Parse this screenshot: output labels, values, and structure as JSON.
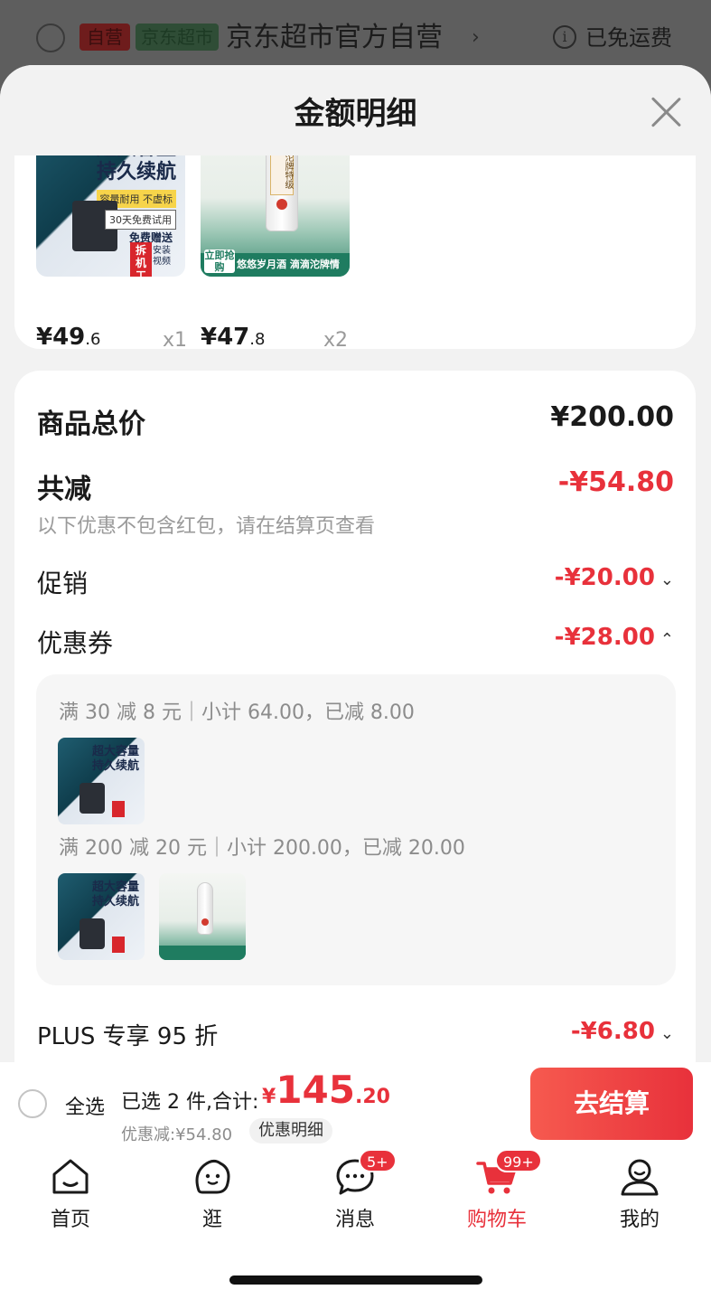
{
  "background_header": {
    "tag_self_run": "自营",
    "tag_supermarket": "京东超市",
    "store_name": "京东超市官方自营",
    "arrow": "›",
    "info_icon_glyph": "i",
    "shipping": "已免运费"
  },
  "sheet": {
    "title": "金额明细",
    "goods": [
      {
        "image_text": [
          "超大容量",
          "持久续航"
        ],
        "badge": "容量耐用 不虚标",
        "trial": "30天免费试用",
        "gift": "免费赠送",
        "red_tag": "拆机工具",
        "video": "安装视频",
        "price_int": "¥49",
        "price_dec": ".6",
        "qty": "x1"
      },
      {
        "image_text": [
          "沱牌特级"
        ],
        "band_text": "悠悠岁月酒 滴滴沱牌情",
        "grab_text": "立即抢购",
        "price_int": "¥47",
        "price_dec": ".8",
        "qty": "x2"
      }
    ],
    "summary": {
      "goods_total_label": "商品总价",
      "goods_total_value": "¥200.00",
      "total_reduction_label": "共减",
      "total_reduction_value": "-¥54.80",
      "hint": "以下优惠不包含红包，请在结算页查看",
      "promotion_label": "促销",
      "promotion_value": "-¥20.00",
      "coupon_label": "优惠券",
      "coupon_value": "-¥28.00",
      "coupon_lines": [
        "满 30 减 8 元｜小计 64.00，已减 8.00",
        "满 200 减 20 元｜小计 200.00，已减 20.00"
      ],
      "plus_label": "PLUS 专享 95 折",
      "plus_value": "-¥6.80",
      "chevron_down": "⌄",
      "chevron_up": "⌃"
    }
  },
  "checkout": {
    "select_all": "全选",
    "selected_text": "已选 2 件,合计:",
    "total_currency": "¥",
    "total_int": "145",
    "total_dec": ".20",
    "discount_text": "优惠减:¥54.80",
    "detail_button": "优惠明细",
    "checkout_button": "去结算"
  },
  "tabbar": {
    "tabs": [
      {
        "label": "首页",
        "icon": "home-icon"
      },
      {
        "label": "逛",
        "icon": "explore-icon"
      },
      {
        "label": "消息",
        "icon": "message-icon",
        "badge": "5+"
      },
      {
        "label": "购物车",
        "icon": "cart-icon",
        "badge": "99+",
        "active": true
      },
      {
        "label": "我的",
        "icon": "profile-icon"
      }
    ]
  },
  "colors": {
    "accent_red": "#e8313b",
    "sheet_bg": "#f2f2f2",
    "dim_overlay": "#5e5e5e"
  }
}
